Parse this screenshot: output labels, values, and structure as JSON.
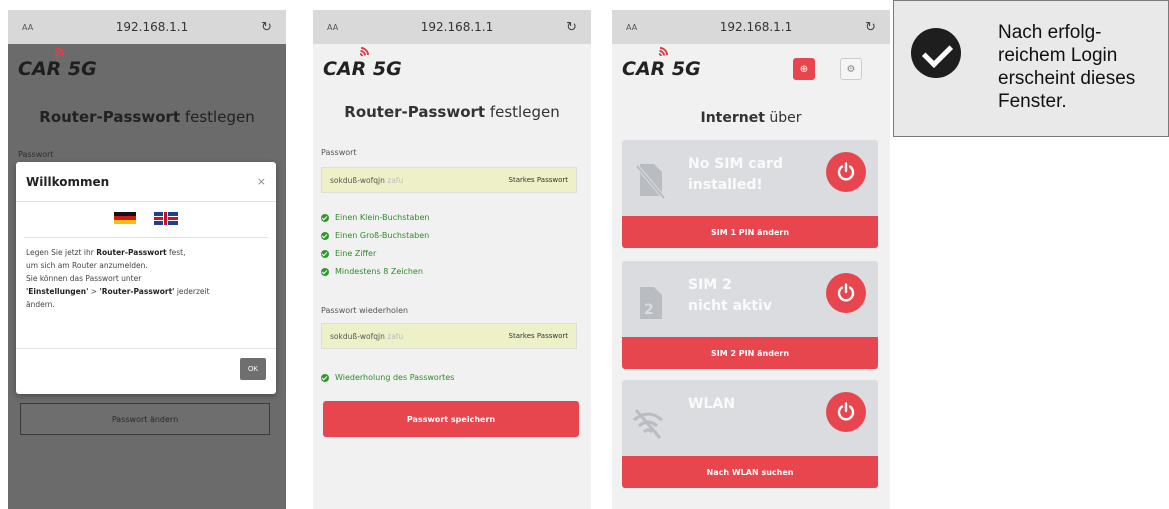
{
  "browser": {
    "text_size": "AA",
    "url": "192.168.1.1",
    "reload_icon": "reload-icon"
  },
  "brand": {
    "logo": "CAR 5G"
  },
  "screen1": {
    "title_bold": "Router-Passwort",
    "title_rest": " festlegen",
    "password_label": "Passwort",
    "modal": {
      "title": "Willkommen",
      "close": "×",
      "line1_a": "Legen Sie jetzt ihr ",
      "line1_b": "Router-Passwort",
      "line1_c": " fest,",
      "line2": "um sich am Router anzumelden.",
      "line3": "Sie können das Passwort unter",
      "line4_a": "'Einstellungen'",
      "line4_b": " > ",
      "line4_c": "'Router-Passwort'",
      "line4_d": " jederzeit",
      "line5": "ändern.",
      "ok": "OK"
    },
    "change_button": "Passwort ändern"
  },
  "screen2": {
    "title_bold": "Router-Passwort",
    "title_rest": " festlegen",
    "password_label": "Passwort",
    "password_value": "sokduß-wofqjn",
    "password_faded": " zafu",
    "strength": "Starkes Passwort",
    "checks": [
      "Einen Klein-Buchstaben",
      "Einen Groß-Buchstaben",
      "Eine Ziffer",
      "Mindestens 8 Zeichen"
    ],
    "repeat_label": "Passwort wiederholen",
    "repeat_value": "sokduß-wofqjn",
    "repeat_faded": " zafu",
    "repeat_strength": "Starkes Passwort",
    "repeat_check": "Wiederholung des Passwortes",
    "save_button": "Passwort speichern"
  },
  "screen3": {
    "title_bold": "Internet",
    "title_rest": " über",
    "cards": [
      {
        "line1": "No SIM card",
        "line2": "installed!",
        "action": "SIM 1 PIN ändern",
        "icon": "no-sim-icon"
      },
      {
        "line1": "SIM 2",
        "line2": "nicht aktiv",
        "action": "SIM 2 PIN ändern",
        "icon": "sim-2-icon"
      },
      {
        "line1": "WLAN",
        "line2": "",
        "action": "Nach WLAN suchen",
        "icon": "wifi-off-icon"
      }
    ],
    "colors": {
      "accent": "#e8464f",
      "card": "#dadce0"
    }
  },
  "info": {
    "line1": "Nach erfolg-",
    "line2": "reichem Login",
    "line3": "erscheint dieses",
    "line4": "Fenster."
  }
}
